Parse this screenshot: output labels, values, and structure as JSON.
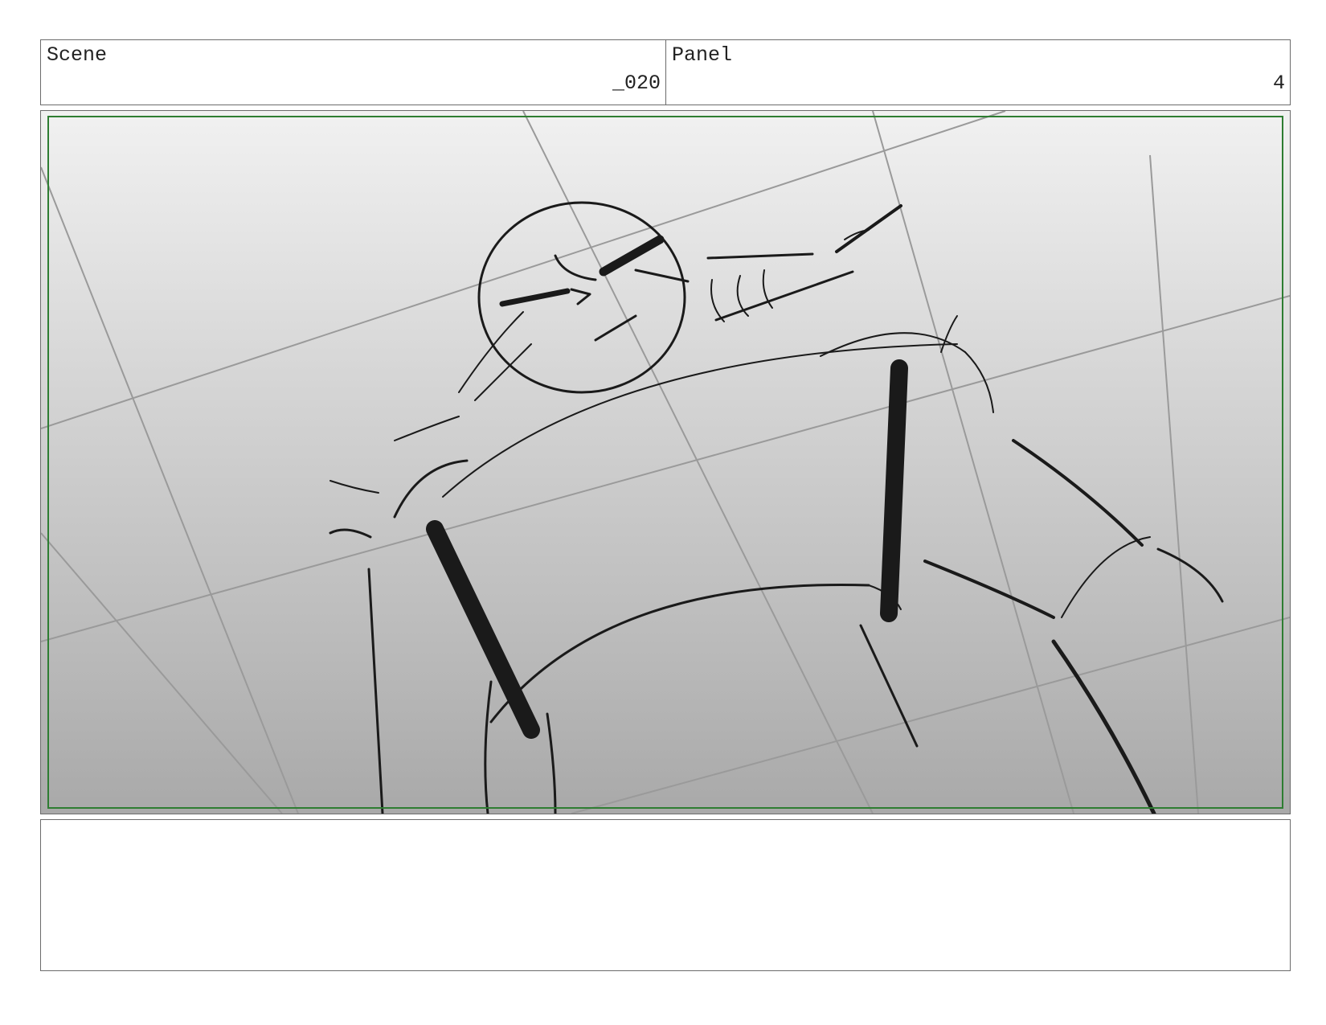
{
  "header": {
    "scene_label": "Scene",
    "scene_value": "_020",
    "panel_label": "Panel",
    "panel_value": "4"
  },
  "notes": {
    "text": ""
  },
  "colors": {
    "safe_frame": "#2e7d32",
    "border": "#6b6b6b",
    "gradient_top": "#f1f1f1",
    "gradient_bottom": "#a9a9a9"
  },
  "icons": {
    "drawing": "storyboard-sketch-image"
  }
}
